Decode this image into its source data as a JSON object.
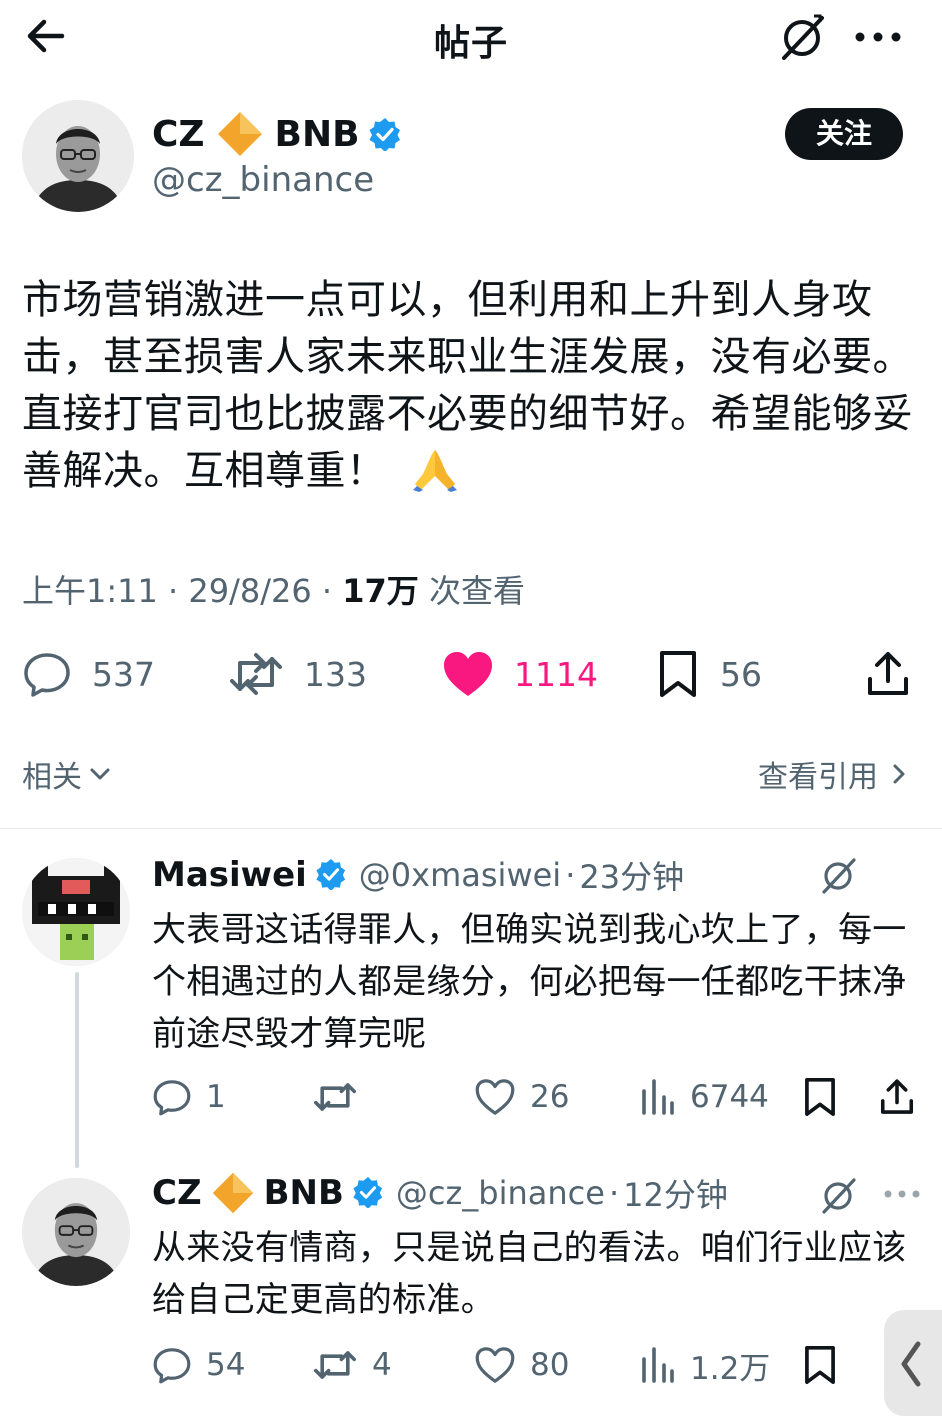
{
  "header": {
    "title": "帖子",
    "icons": [
      "back-arrow-icon",
      "grok-icon",
      "more-icon"
    ]
  },
  "post": {
    "author": {
      "name": "CZ",
      "name_suffix": "BNB",
      "handle": "@cz_binance",
      "badges": [
        "diamond-icon",
        "verified-icon"
      ]
    },
    "follow_label": "关注",
    "text": "市场营销激进一点可以，但利用和上升到人身攻击，甚至损害人家未来职业生涯发展，没有必要。直接打官司也比披露不必要的细节好。希望能够妥善解决。互相尊重！",
    "emoji": "🙏",
    "meta": {
      "time": "上午1:11",
      "sep1": "·",
      "date": "29/8/26",
      "sep2": "·",
      "views_count": "17万",
      "views_label": "次查看"
    },
    "actions": {
      "replies": "537",
      "reposts": "133",
      "likes": "1114",
      "bookmarks": "56"
    }
  },
  "related_label": "相关",
  "view_quotes_label": "查看引用",
  "replies": [
    {
      "name": "Masiwei",
      "handle": "@0xmasiwei",
      "sep": "·",
      "time": "23分钟",
      "text": "大表哥这话得罪人，但确实说到我心坎上了，每一个相遇过的人都是缘分，何必把每一任都吃干抹净前途尽毁才算完呢",
      "replies": "1",
      "reposts": "",
      "likes": "26",
      "views": "6744"
    },
    {
      "name": "CZ",
      "name_suffix": "BNB",
      "handle": "@cz_binance",
      "sep": "·",
      "time": "12分钟",
      "text": "从来没有情商，只是说自己的看法。咱们行业应该给自己定更高的标准。",
      "replies": "54",
      "reposts": "4",
      "likes": "80",
      "views": "1.2万"
    }
  ],
  "colors": {
    "text": "#0f1419",
    "secondary": "#536471",
    "like": "#f91880",
    "verified": "#1d9bf0",
    "diamond": "#f3a52b"
  }
}
